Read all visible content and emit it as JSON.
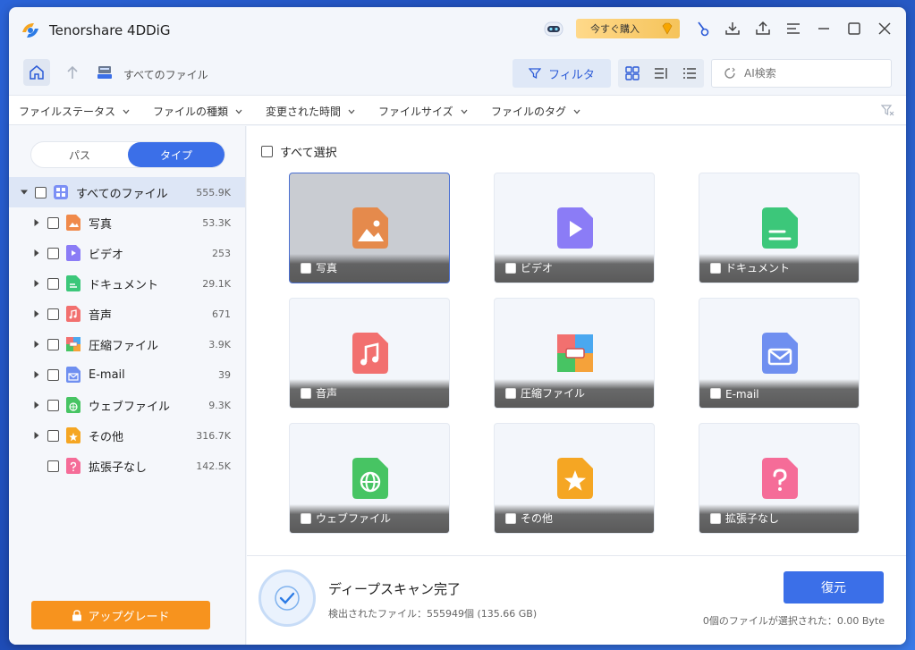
{
  "app": {
    "title": "Tenorshare 4DDiG",
    "buy_label": "今すぐ購入"
  },
  "nav": {
    "breadcrumb": "すべてのファイル",
    "filter_label": "フィルタ",
    "search_placeholder": "AI検索"
  },
  "filters": [
    "ファイルステータス",
    "ファイルの種類",
    "変更された時間",
    "ファイルサイズ",
    "ファイルのタグ"
  ],
  "sidebar": {
    "tab_path": "パス",
    "tab_type": "タイプ",
    "root": {
      "label": "すべてのファイル",
      "count": "555.9K"
    },
    "items": [
      {
        "label": "写真",
        "count": "53.3K",
        "icon": "photo-icon",
        "color": "#f08a4b"
      },
      {
        "label": "ビデオ",
        "count": "253",
        "icon": "video-icon",
        "color": "#8b7cf6"
      },
      {
        "label": "ドキュメント",
        "count": "29.1K",
        "icon": "document-icon",
        "color": "#3cc77a"
      },
      {
        "label": "音声",
        "count": "671",
        "icon": "audio-icon",
        "color": "#f2706f"
      },
      {
        "label": "圧縮ファイル",
        "count": "3.9K",
        "icon": "archive-icon",
        "color": "#f5a23a"
      },
      {
        "label": "E-mail",
        "count": "39",
        "icon": "email-icon",
        "color": "#6f8ff0"
      },
      {
        "label": "ウェブファイル",
        "count": "9.3K",
        "icon": "web-icon",
        "color": "#47c463"
      },
      {
        "label": "その他",
        "count": "316.7K",
        "icon": "other-icon",
        "color": "#f5a623"
      },
      {
        "label": "拡張子なし",
        "count": "142.5K",
        "icon": "no-extension-icon",
        "color": "#f56c98"
      }
    ],
    "upgrade_label": "アップグレード"
  },
  "main": {
    "select_all": "すべて選択",
    "tiles": [
      "写真",
      "ビデオ",
      "ドキュメント",
      "音声",
      "圧縮ファイル",
      "E-mail",
      "ウェブファイル",
      "その他",
      "拡張子なし"
    ]
  },
  "footer": {
    "scan_title": "ディープスキャン完了",
    "scan_detail": "検出されたファイル：555949個 (135.66 GB)",
    "recover_label": "復元",
    "selection_info": "0個のファイルが選択された：0.00 Byte"
  },
  "colors": {
    "accent": "#3b6fe8",
    "upgrade": "#f7931e"
  }
}
